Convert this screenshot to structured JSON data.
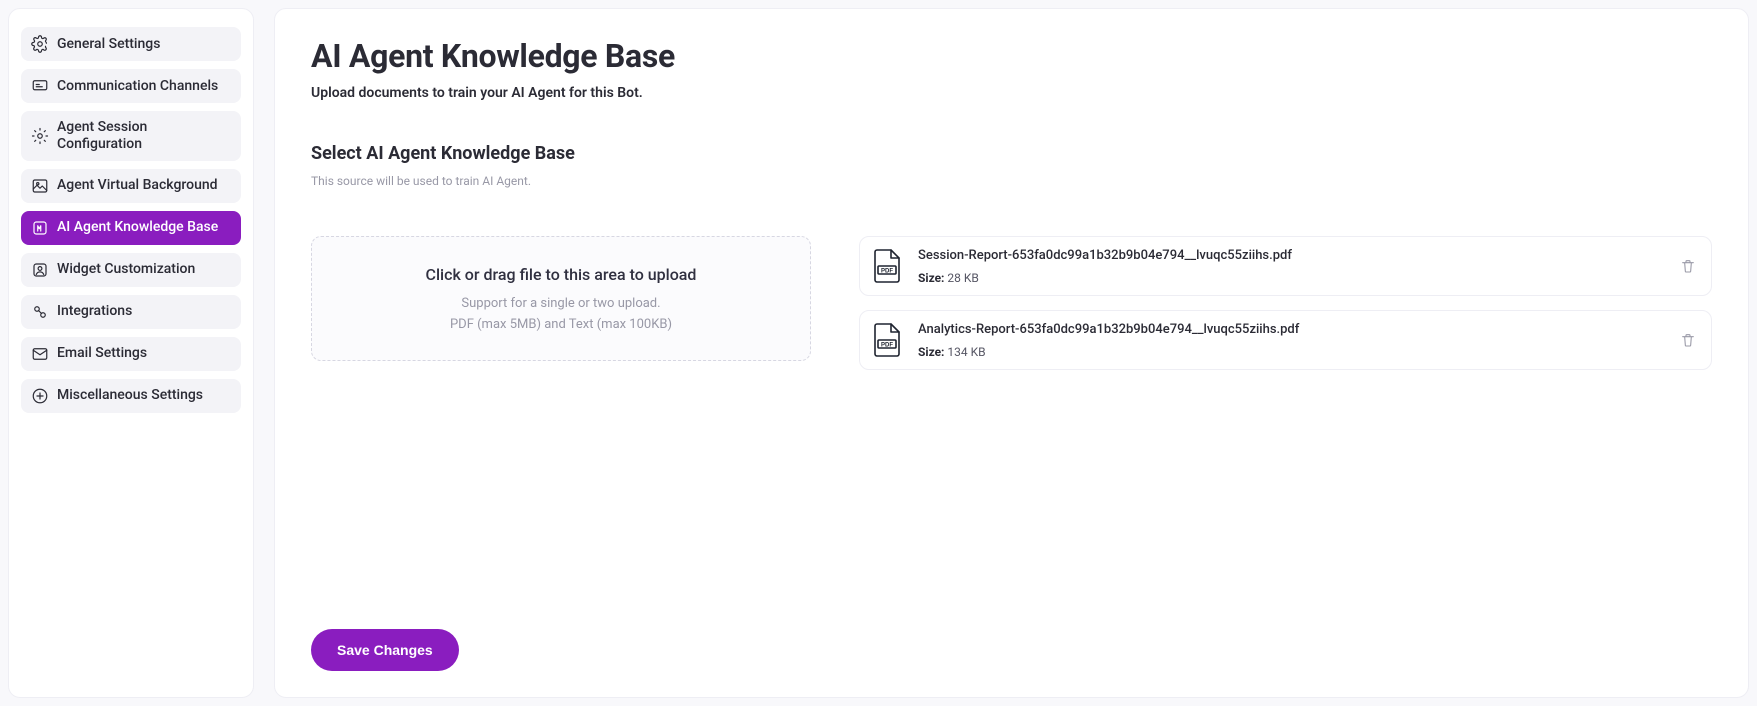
{
  "sidebar": {
    "items": [
      {
        "label": "General Settings"
      },
      {
        "label": "Communication Channels"
      },
      {
        "label": "Agent Session Configuration"
      },
      {
        "label": "Agent Virtual Background"
      },
      {
        "label": "AI Agent Knowledge Base"
      },
      {
        "label": "Widget Customization"
      },
      {
        "label": "Integrations"
      },
      {
        "label": "Email Settings"
      },
      {
        "label": "Miscellaneous Settings"
      }
    ],
    "active_index": 4
  },
  "page": {
    "title": "AI Agent Knowledge Base",
    "subtitle": "Upload documents to train your AI Agent for this Bot."
  },
  "section": {
    "title": "Select AI Agent Knowledge Base",
    "description": "This source will be used to train AI Agent."
  },
  "upload": {
    "title": "Click or drag file to this area to upload",
    "hint1": "Support for a single or two upload.",
    "hint2": "PDF (max 5MB) and Text (max 100KB)"
  },
  "files": [
    {
      "name": "Session-Report-653fa0dc99a1b32b9b04e794__lvuqc55ziihs.pdf",
      "size_label": "Size:",
      "size": "28 KB"
    },
    {
      "name": "Analytics-Report-653fa0dc99a1b32b9b04e794__lvuqc55ziihs.pdf",
      "size_label": "Size:",
      "size": "134 KB"
    }
  ],
  "actions": {
    "save": "Save Changes"
  },
  "colors": {
    "accent": "#8a1dbf"
  }
}
